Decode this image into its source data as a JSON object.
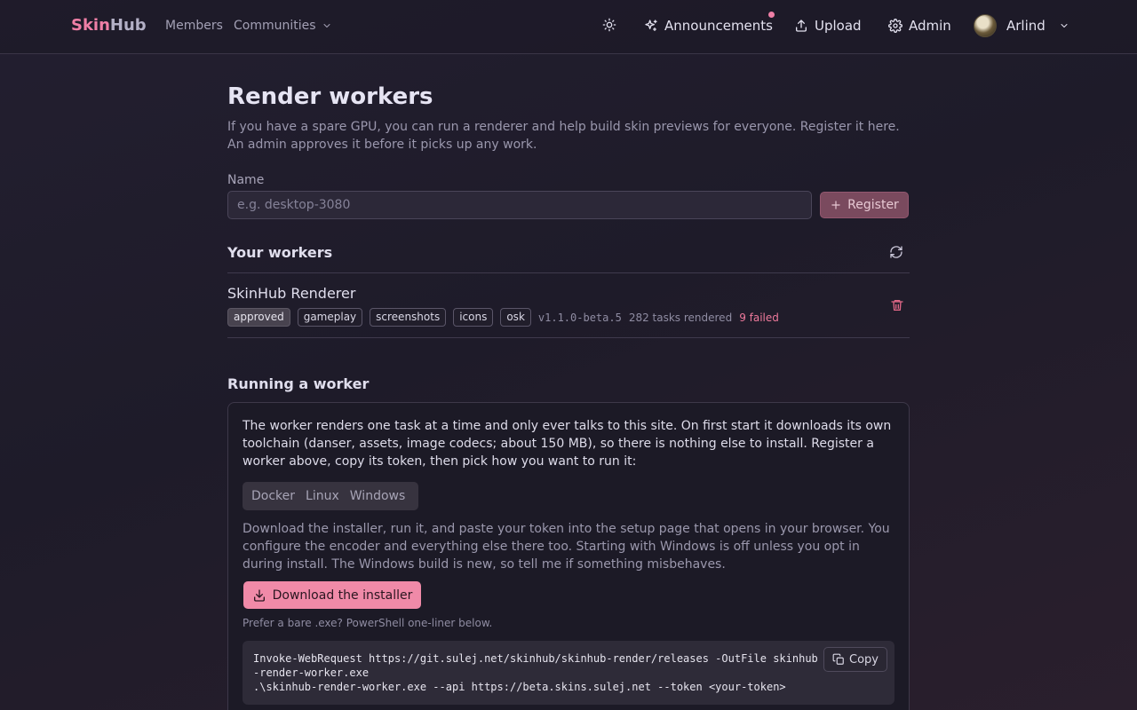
{
  "nav": {
    "brand_a": "Skin",
    "brand_b": "Hub",
    "members": "Members",
    "communities": "Communities",
    "announcements": "Announcements",
    "upload": "Upload",
    "admin": "Admin",
    "user": "Arlind",
    "icons": [
      "sun-icon",
      "sparkles-icon",
      "upload-icon",
      "gear-icon",
      "chevron-down-icon"
    ]
  },
  "page": {
    "title": "Render workers",
    "intro": "If you have a spare GPU, you can run a renderer and help build skin previews for everyone. Register it here. An admin approves it before it picks up any work.",
    "name_label": "Name",
    "name_placeholder": "e.g. desktop-3080",
    "name_value": "",
    "register_label": "Register"
  },
  "workers": {
    "heading": "Your workers",
    "items": [
      {
        "name": "SkinHub Renderer",
        "status": "approved",
        "capabilities": [
          "gameplay",
          "screenshots",
          "icons",
          "osk"
        ],
        "version": "v1.1.0-beta.5",
        "tasks": "282 tasks rendered",
        "failed": "9 failed"
      }
    ]
  },
  "running": {
    "heading": "Running a worker",
    "description": "The worker renders one task at a time and only ever talks to this site. On first start it downloads its own toolchain (danser, assets, image codecs; about 150 MB), so there is nothing else to install. Register a worker above, copy its token, then pick how you want to run it:",
    "tabs": [
      "Docker",
      "Linux",
      "Windows"
    ],
    "active_tab": "Windows",
    "windows_text": "Download the installer, run it, and paste your token into the setup page that opens in your browser. You configure the encoder and everything else there too. Starting with Windows is off unless you opt in during install. The Windows build is new, so tell me if something misbehaves.",
    "download_label": "Download the installer",
    "prefer_text": "Prefer a bare .exe? PowerShell one-liner below.",
    "code": "Invoke-WebRequest https://git.sulej.net/skinhub/skinhub-render/releases -OutFile skinhub-render-worker.exe\n.\\skinhub-render-worker.exe --api https://beta.skins.sulej.net --token <your-token>",
    "copy_label": "Copy"
  },
  "colors": {
    "accent": "#f08aa8",
    "danger": "#ee7a9c",
    "background": "#221e2d"
  }
}
